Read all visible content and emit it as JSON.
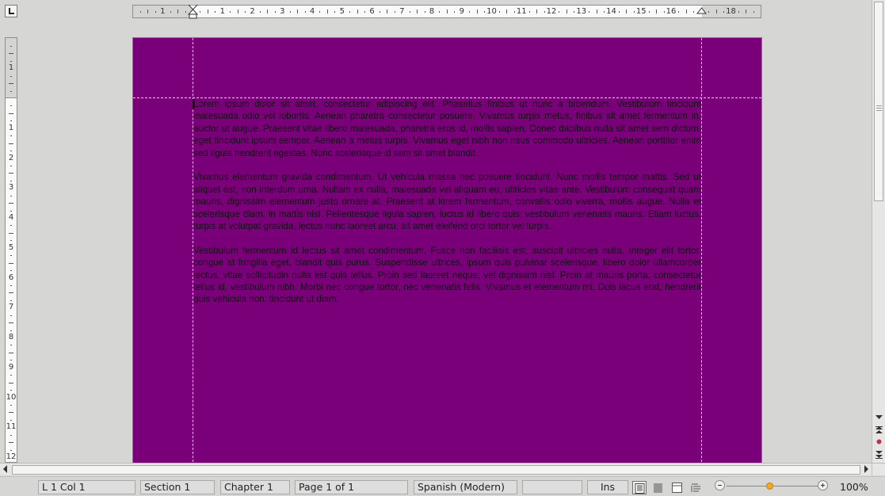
{
  "document": {
    "paragraphs": [
      "Lorem ipsum dolor sit amet, consectetur adipiscing elit. Phasellus finibus ut nunc a bibendum. Vestibulum tincidunt malesuada odio vel lobortis. Aenean pharetra consectetur posuere. Vivamus turpis metus, finibus sit amet fermentum in, auctor ut augue. Praesent vitae libero malesuada, pharetra eros id, mollis sapien. Donec dapibus nulla sit amet sem dictum, eget tincidunt ipsum semper. Aenean a metus turpis. Vivamus eget nibh non risus commodo ultricies. Aenean porttitor enim sed ligula hendrerit egestas. Nunc scelerisque id sem sit amet blandit.",
      "Vivamus elementum gravida condimentum. Ut vehicula massa nec posuere tincidunt. Nunc mollis tempor mattis. Sed ut aliquet est, non interdum urna. Nullam ex nulla, malesuada vel aliquam eu, ultricies vitae ante. Vestibulum consequat quam mauris, dignissim elementum justo ornare at. Praesent at lorem fermentum, convallis odio viverra, mollis augue. Nulla et scelerisque diam, in mattis nisl. Pellentesque ligula sapien, luctus id libero quis, vestibulum venenatis mauris. Etiam luctus, turpis at volutpat gravida, lectus nunc laoreet arcu, sit amet eleifend orci tortor vel turpis.",
      "Vestibulum fermentum id lectus sit amet condimentum. Fusce non facilisis est, suscipit ultricies nulla. Integer elit tortor, congue at fringilla eget, blandit quis purus. Suspendisse ultrices, ipsum quis pulvinar scelerisque, libero dolor ullamcorper lectus, vitae sollicitudin nulla est quis tellus. Proin sed laoreet neque, vel dignissim nisl. Proin at mauris porta, consectetur tellus id, vestibulum nibh. Morbi nec congue tortor, nec venenatis felis. Vivamus et elementum mi. Duis lacus erat, hendrerit quis vehicula non, tincidunt ut diam."
    ],
    "page_color": "#7a007a"
  },
  "ruler": {
    "horizontal_numbers": [
      "1",
      "1",
      "2",
      "3",
      "4",
      "5",
      "6",
      "7",
      "8",
      "9",
      "10",
      "11",
      "12",
      "13",
      "14",
      "15",
      "16",
      "18"
    ],
    "vertical_numbers": [
      "1",
      "1",
      "2",
      "3",
      "4",
      "5",
      "6",
      "7",
      "8",
      "9",
      "10",
      "11",
      "12"
    ]
  },
  "status_bar": {
    "position": "L 1 Col 1",
    "section": "Section 1",
    "chapter": "Chapter 1",
    "page": "Page 1 of 1",
    "language": "Spanish (Modern)",
    "blank": "",
    "insert_mode": "Ins",
    "zoom": "100%",
    "zoom_level": 1.0
  },
  "icons": {
    "tab_stop": "tab-stop-left-icon",
    "view_single": "single-page-view-icon",
    "view_multi": "multi-page-view-icon",
    "view_book": "book-view-icon",
    "view_web": "web-view-icon",
    "prev_page": "double-up-arrow-icon",
    "next_page": "double-down-arrow-icon",
    "navigator": "navigator-dot-icon"
  },
  "colors": {
    "zoom_thumb": "#f2a81f",
    "navigator_dot": "#c0304a"
  }
}
